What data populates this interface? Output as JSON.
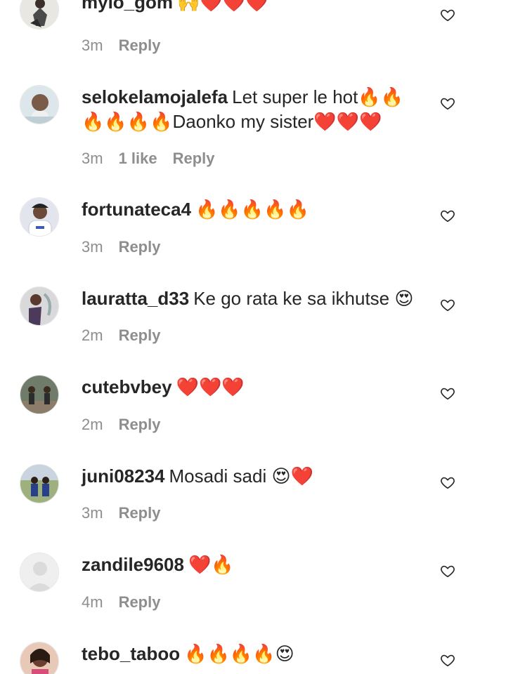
{
  "comments": [
    {
      "username": "mylo_gom",
      "text": "🙌❤️❤️❤️",
      "time": "3m",
      "likes": "",
      "reply": "Reply"
    },
    {
      "username": "selokelamojalefa",
      "text": "Let super le hot🔥🔥🔥🔥🔥🔥Daonko my sister❤️❤️❤️",
      "time": "3m",
      "likes": "1 like",
      "reply": "Reply"
    },
    {
      "username": "fortunateca4",
      "text": "🔥🔥🔥🔥🔥",
      "time": "3m",
      "likes": "",
      "reply": "Reply"
    },
    {
      "username": "lauratta_d33",
      "text": "Ke go rata ke sa ikhutse 😍",
      "time": "2m",
      "likes": "",
      "reply": "Reply"
    },
    {
      "username": "cutebvbey",
      "text": "❤️❤️❤️",
      "time": "2m",
      "likes": "",
      "reply": "Reply"
    },
    {
      "username": "juni08234",
      "text": "Mosadi sadi 😍❤️",
      "time": "3m",
      "likes": "",
      "reply": "Reply"
    },
    {
      "username": "zandile9608",
      "text": "❤️🔥",
      "time": "4m",
      "likes": "",
      "reply": "Reply"
    },
    {
      "username": "tebo_taboo",
      "text": "🔥🔥🔥🔥😍",
      "time": "",
      "likes": "",
      "reply": ""
    }
  ],
  "icons": {
    "like": "heart-outline-icon",
    "avatar_placeholder": "default-avatar-icon"
  },
  "colors": {
    "text": "#262626",
    "muted": "#8e8e8e",
    "background": "#ffffff"
  }
}
